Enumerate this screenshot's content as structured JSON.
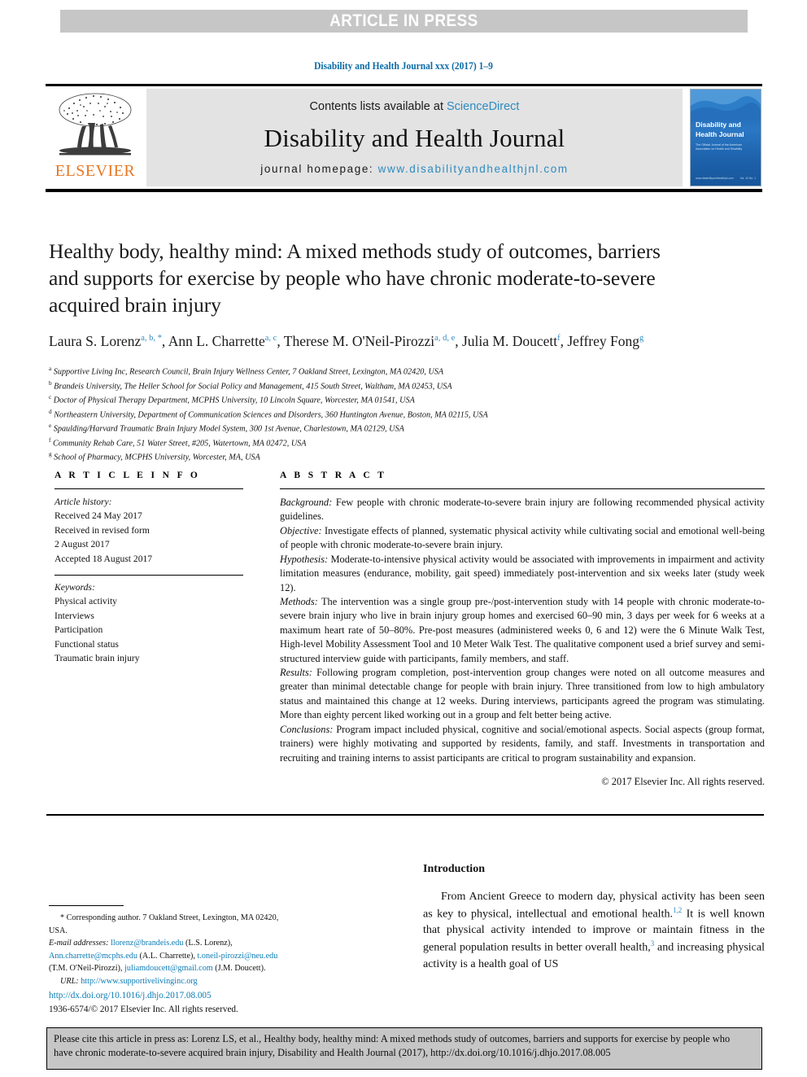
{
  "banner": {
    "label": "ARTICLE IN PRESS"
  },
  "running_head": {
    "text": "Disability and Health Journal xxx (2017) 1–9"
  },
  "masthead": {
    "publisher": "ELSEVIER",
    "contents_prefix": "Contents lists available at ",
    "contents_link": "ScienceDirect",
    "journal_name": "Disability and Health Journal",
    "homepage_prefix": "journal homepage: ",
    "homepage_url": "www.disabilityandhealthjnl.com",
    "cover": {
      "title_line1": "Disability and",
      "title_line2": "Health Journal",
      "subtitle": "The Official Journal of the American Association on Health and Disability",
      "foot_left": "www.disabilityandhealthjnl.com",
      "foot_right": "ISSN 1936-6574",
      "volume": "Vol. 10  No. 1"
    }
  },
  "article": {
    "title": "Healthy body, healthy mind: A mixed methods study of outcomes, barriers and supports for exercise by people who have chronic moderate-to-severe acquired brain injury",
    "authors": [
      {
        "name": "Laura S. Lorenz",
        "marks": "a, b, *"
      },
      {
        "name": "Ann L. Charrette",
        "marks": "a, c"
      },
      {
        "name": "Therese M. O'Neil-Pirozzi",
        "marks": "a, d, e"
      },
      {
        "name": "Julia M. Doucett",
        "marks": "f"
      },
      {
        "name": "Jeffrey Fong",
        "marks": "g"
      }
    ],
    "affiliations": [
      {
        "mark": "a",
        "text": "Supportive Living Inc, Research Council, Brain Injury Wellness Center, 7 Oakland Street, Lexington, MA 02420, USA"
      },
      {
        "mark": "b",
        "text": "Brandeis University, The Heller School for Social Policy and Management, 415 South Street, Waltham, MA 02453, USA"
      },
      {
        "mark": "c",
        "text": "Doctor of Physical Therapy Department, MCPHS University, 10 Lincoln Square, Worcester, MA 01541, USA"
      },
      {
        "mark": "d",
        "text": "Northeastern University, Department of Communication Sciences and Disorders, 360 Huntington Avenue, Boston, MA 02115, USA"
      },
      {
        "mark": "e",
        "text": "Spaulding/Harvard Traumatic Brain Injury Model System, 300 1st Avenue, Charlestown, MA 02129, USA"
      },
      {
        "mark": "f",
        "text": "Community Rehab Care, 51 Water Street, #205, Watertown, MA 02472, USA"
      },
      {
        "mark": "g",
        "text": "School of Pharmacy, MCPHS University, Worcester, MA, USA"
      }
    ]
  },
  "article_info": {
    "heading": "A R T I C L E   I N F O",
    "history_label": "Article history:",
    "history": [
      "Received 24 May 2017",
      "Received in revised form",
      "2 August 2017",
      "Accepted 18 August 2017"
    ],
    "keywords_label": "Keywords:",
    "keywords": [
      "Physical activity",
      "Interviews",
      "Participation",
      "Functional status",
      "Traumatic brain injury"
    ]
  },
  "abstract": {
    "heading": "A B S T R A C T",
    "sections": [
      {
        "label": "Background:",
        "text": " Few people with chronic moderate-to-severe brain injury are following recommended physical activity guidelines."
      },
      {
        "label": "Objective:",
        "text": " Investigate effects of planned, systematic physical activity while cultivating social and emotional well-being of people with chronic moderate-to-severe brain injury."
      },
      {
        "label": "Hypothesis:",
        "text": " Moderate-to-intensive physical activity would be associated with improvements in impairment and activity limitation measures (endurance, mobility, gait speed) immediately post-intervention and six weeks later (study week 12)."
      },
      {
        "label": "Methods:",
        "text": " The intervention was a single group pre-/post-intervention study with 14 people with chronic moderate-to-severe brain injury who live in brain injury group homes and exercised 60–90 min, 3 days per week for 6 weeks at a maximum heart rate of 50–80%. Pre-post measures (administered weeks 0, 6 and 12) were the 6 Minute Walk Test, High-level Mobility Assessment Tool and 10 Meter Walk Test. The qualitative component used a brief survey and semi-structured interview guide with participants, family members, and staff."
      },
      {
        "label": "Results:",
        "text": " Following program completion, post-intervention group changes were noted on all outcome measures and greater than minimal detectable change for people with brain injury. Three transitioned from low to high ambulatory status and maintained this change at 12 weeks. During interviews, participants agreed the program was stimulating. More than eighty percent liked working out in a group and felt better being active."
      },
      {
        "label": "Conclusions:",
        "text": " Program impact included physical, cognitive and social/emotional aspects. Social aspects (group format, trainers) were highly motivating and supported by residents, family, and staff. Investments in transportation and recruiting and training interns to assist participants are critical to program sustainability and expansion."
      }
    ],
    "copyright": "© 2017 Elsevier Inc. All rights reserved."
  },
  "footnotes": {
    "corresponding": "Corresponding author. 7 Oakland Street, Lexington, MA 02420, USA.",
    "email_label": "E-mail addresses:",
    "emails": [
      {
        "address": "llorenz@brandeis.edu",
        "who": " (L.S. Lorenz), "
      },
      {
        "address": "Ann.charrette@mcphs.edu",
        "who": " (A.L. Charrette), "
      },
      {
        "address": "t.oneil-pirozzi@neu.edu",
        "who": " (T.M. O'Neil-Pirozzi), "
      },
      {
        "address": "juliamdoucett@gmail.com",
        "who": " (J.M. Doucett)."
      }
    ],
    "url_label": "URL:",
    "url": "http://www.supportivelivinginc.org",
    "doi": "http://dx.doi.org/10.1016/j.dhjo.2017.08.005",
    "issn_line": "1936-6574/© 2017 Elsevier Inc. All rights reserved."
  },
  "introduction": {
    "heading": "Introduction",
    "paragraph_1": "From Ancient Greece to modern day, physical activity has been seen as key to physical, intellectual and emotional health.",
    "ref_1": "1,2",
    "paragraph_2": " It is well known that physical activity intended to improve or maintain fitness in the general population results in better overall health,",
    "ref_2": "3",
    "paragraph_3": " and increasing physical activity is a health goal of US"
  },
  "cite_box": {
    "text": "Please cite this article in press as: Lorenz LS, et al., Healthy body, healthy mind: A mixed methods study of outcomes, barriers and supports for exercise by people who have chronic moderate-to-severe acquired brain injury, Disability and Health Journal (2017), http://dx.doi.org/10.1016/j.dhjo.2017.08.005"
  },
  "colors": {
    "link": "#0b7bb5",
    "accent_blue": "#2e8bc0",
    "elsevier_orange": "#e87722",
    "banner_gray": "#c6c6c6",
    "masthead_gray": "#e3e3e3"
  }
}
